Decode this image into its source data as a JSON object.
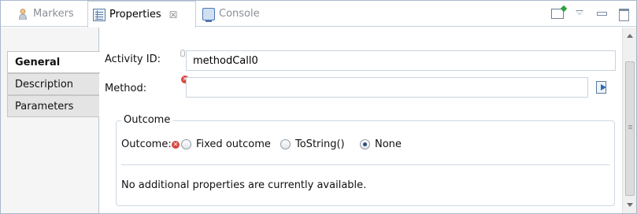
{
  "tabs": [
    {
      "label": "Markers",
      "icon": "markers-icon",
      "active": false
    },
    {
      "label": "Properties",
      "icon": "properties-icon",
      "active": true,
      "close_glyph": "☒"
    },
    {
      "label": "Console",
      "icon": "console-icon",
      "active": false
    }
  ],
  "view_actions": [
    "pin-icon",
    "view-menu-icon",
    "minimize-icon",
    "maximize-icon"
  ],
  "side_tabs": [
    {
      "label": "General",
      "active": true
    },
    {
      "label": "Description",
      "active": false
    },
    {
      "label": "Parameters",
      "active": false
    }
  ],
  "general": {
    "activity_id_label": "Activity ID:",
    "activity_id_value": "methodCall0",
    "method_label": "Method:",
    "method_value": "",
    "error_glyph": "✕",
    "outcome_group_title": "Outcome",
    "outcome_label": "Outcome:",
    "outcome_options": [
      {
        "label": "Fixed outcome",
        "checked": false
      },
      {
        "label": "ToString()",
        "checked": false
      },
      {
        "label": "None",
        "checked": true
      }
    ],
    "info_text": "No additional properties are currently available."
  },
  "colors": {
    "frame_border": "#a9b8cc",
    "error_red": "#d8463f",
    "radio_selected": "#2c4e7a",
    "accent_green": "#2fa043"
  }
}
